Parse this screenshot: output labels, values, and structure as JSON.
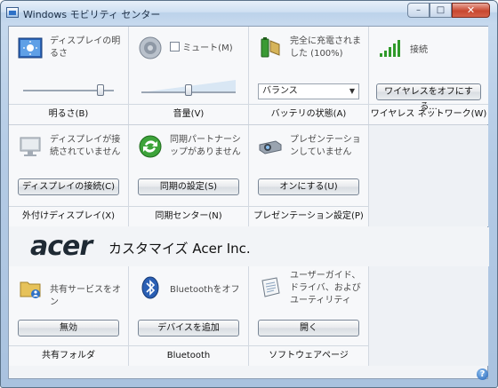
{
  "window": {
    "title": "Windows モビリティ センター",
    "minimize": "–",
    "maximize": "□",
    "close": "✕"
  },
  "tiles": {
    "brightness": {
      "text": "ディスプレイの明るさ",
      "footer": "明るさ(B)",
      "level": 0.85
    },
    "volume": {
      "checkbox_label": "ミュート(M)",
      "footer": "音量(V)",
      "level": 0.5,
      "muted": false
    },
    "battery": {
      "text": "完全に充電されました (100%)",
      "select_value": "バランス",
      "footer": "バッテリの状態(A)",
      "percent": 100
    },
    "wireless": {
      "text": "接続",
      "button": "ワイヤレスをオフにする...",
      "footer": "ワイヤレス ネットワーク(W)"
    },
    "display": {
      "text": "ディスプレイが接続されていません",
      "button": "ディスプレイの接続(C)",
      "footer": "外付けディスプレイ(X)"
    },
    "sync": {
      "text": "同期パートナーシップがありません",
      "button": "同期の設定(S)",
      "footer": "同期センター(N)"
    },
    "presentation": {
      "text": "プレゼンテーションしていません",
      "button": "オンにする(U)",
      "footer": "プレゼンテーション設定(P)"
    },
    "sharing": {
      "text": "共有サービスをオン",
      "button": "無効",
      "footer": "共有フォルダ"
    },
    "bluetooth": {
      "text": "Bluetoothをオフ",
      "button": "デバイスを追加",
      "footer": "Bluetooth"
    },
    "software": {
      "text": "ユーザーガイド、ドライバ、およびユーティリティ",
      "button": "開く",
      "footer": "ソフトウェアページ"
    }
  },
  "brand": {
    "logo": "acer",
    "text": "カスタマイズ Acer Inc."
  },
  "help": "?",
  "colors": {
    "accent": "#2e71c7",
    "signal": "#2f9a2a",
    "window_frame": "#b4cbe5"
  }
}
